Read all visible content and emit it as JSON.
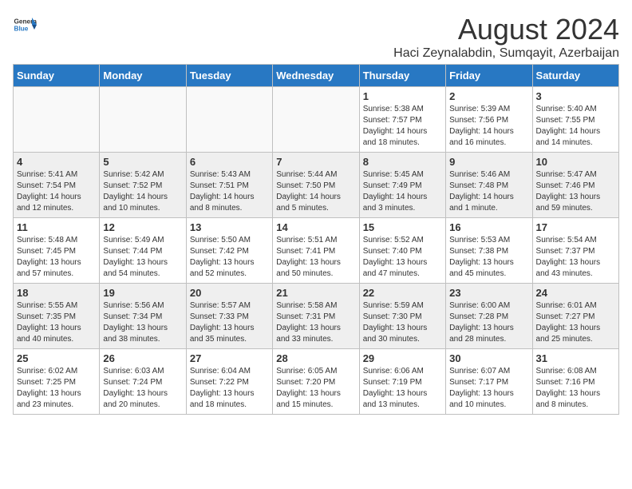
{
  "header": {
    "logo_line1": "General",
    "logo_line2": "Blue",
    "month_year": "August 2024",
    "location": "Haci Zeynalabdin, Sumqayit, Azerbaijan"
  },
  "weekdays": [
    "Sunday",
    "Monday",
    "Tuesday",
    "Wednesday",
    "Thursday",
    "Friday",
    "Saturday"
  ],
  "weeks": [
    [
      {
        "day": "",
        "info": ""
      },
      {
        "day": "",
        "info": ""
      },
      {
        "day": "",
        "info": ""
      },
      {
        "day": "",
        "info": ""
      },
      {
        "day": "1",
        "info": "Sunrise: 5:38 AM\nSunset: 7:57 PM\nDaylight: 14 hours\nand 18 minutes."
      },
      {
        "day": "2",
        "info": "Sunrise: 5:39 AM\nSunset: 7:56 PM\nDaylight: 14 hours\nand 16 minutes."
      },
      {
        "day": "3",
        "info": "Sunrise: 5:40 AM\nSunset: 7:55 PM\nDaylight: 14 hours\nand 14 minutes."
      }
    ],
    [
      {
        "day": "4",
        "info": "Sunrise: 5:41 AM\nSunset: 7:54 PM\nDaylight: 14 hours\nand 12 minutes."
      },
      {
        "day": "5",
        "info": "Sunrise: 5:42 AM\nSunset: 7:52 PM\nDaylight: 14 hours\nand 10 minutes."
      },
      {
        "day": "6",
        "info": "Sunrise: 5:43 AM\nSunset: 7:51 PM\nDaylight: 14 hours\nand 8 minutes."
      },
      {
        "day": "7",
        "info": "Sunrise: 5:44 AM\nSunset: 7:50 PM\nDaylight: 14 hours\nand 5 minutes."
      },
      {
        "day": "8",
        "info": "Sunrise: 5:45 AM\nSunset: 7:49 PM\nDaylight: 14 hours\nand 3 minutes."
      },
      {
        "day": "9",
        "info": "Sunrise: 5:46 AM\nSunset: 7:48 PM\nDaylight: 14 hours\nand 1 minute."
      },
      {
        "day": "10",
        "info": "Sunrise: 5:47 AM\nSunset: 7:46 PM\nDaylight: 13 hours\nand 59 minutes."
      }
    ],
    [
      {
        "day": "11",
        "info": "Sunrise: 5:48 AM\nSunset: 7:45 PM\nDaylight: 13 hours\nand 57 minutes."
      },
      {
        "day": "12",
        "info": "Sunrise: 5:49 AM\nSunset: 7:44 PM\nDaylight: 13 hours\nand 54 minutes."
      },
      {
        "day": "13",
        "info": "Sunrise: 5:50 AM\nSunset: 7:42 PM\nDaylight: 13 hours\nand 52 minutes."
      },
      {
        "day": "14",
        "info": "Sunrise: 5:51 AM\nSunset: 7:41 PM\nDaylight: 13 hours\nand 50 minutes."
      },
      {
        "day": "15",
        "info": "Sunrise: 5:52 AM\nSunset: 7:40 PM\nDaylight: 13 hours\nand 47 minutes."
      },
      {
        "day": "16",
        "info": "Sunrise: 5:53 AM\nSunset: 7:38 PM\nDaylight: 13 hours\nand 45 minutes."
      },
      {
        "day": "17",
        "info": "Sunrise: 5:54 AM\nSunset: 7:37 PM\nDaylight: 13 hours\nand 43 minutes."
      }
    ],
    [
      {
        "day": "18",
        "info": "Sunrise: 5:55 AM\nSunset: 7:35 PM\nDaylight: 13 hours\nand 40 minutes."
      },
      {
        "day": "19",
        "info": "Sunrise: 5:56 AM\nSunset: 7:34 PM\nDaylight: 13 hours\nand 38 minutes."
      },
      {
        "day": "20",
        "info": "Sunrise: 5:57 AM\nSunset: 7:33 PM\nDaylight: 13 hours\nand 35 minutes."
      },
      {
        "day": "21",
        "info": "Sunrise: 5:58 AM\nSunset: 7:31 PM\nDaylight: 13 hours\nand 33 minutes."
      },
      {
        "day": "22",
        "info": "Sunrise: 5:59 AM\nSunset: 7:30 PM\nDaylight: 13 hours\nand 30 minutes."
      },
      {
        "day": "23",
        "info": "Sunrise: 6:00 AM\nSunset: 7:28 PM\nDaylight: 13 hours\nand 28 minutes."
      },
      {
        "day": "24",
        "info": "Sunrise: 6:01 AM\nSunset: 7:27 PM\nDaylight: 13 hours\nand 25 minutes."
      }
    ],
    [
      {
        "day": "25",
        "info": "Sunrise: 6:02 AM\nSunset: 7:25 PM\nDaylight: 13 hours\nand 23 minutes."
      },
      {
        "day": "26",
        "info": "Sunrise: 6:03 AM\nSunset: 7:24 PM\nDaylight: 13 hours\nand 20 minutes."
      },
      {
        "day": "27",
        "info": "Sunrise: 6:04 AM\nSunset: 7:22 PM\nDaylight: 13 hours\nand 18 minutes."
      },
      {
        "day": "28",
        "info": "Sunrise: 6:05 AM\nSunset: 7:20 PM\nDaylight: 13 hours\nand 15 minutes."
      },
      {
        "day": "29",
        "info": "Sunrise: 6:06 AM\nSunset: 7:19 PM\nDaylight: 13 hours\nand 13 minutes."
      },
      {
        "day": "30",
        "info": "Sunrise: 6:07 AM\nSunset: 7:17 PM\nDaylight: 13 hours\nand 10 minutes."
      },
      {
        "day": "31",
        "info": "Sunrise: 6:08 AM\nSunset: 7:16 PM\nDaylight: 13 hours\nand 8 minutes."
      }
    ]
  ]
}
